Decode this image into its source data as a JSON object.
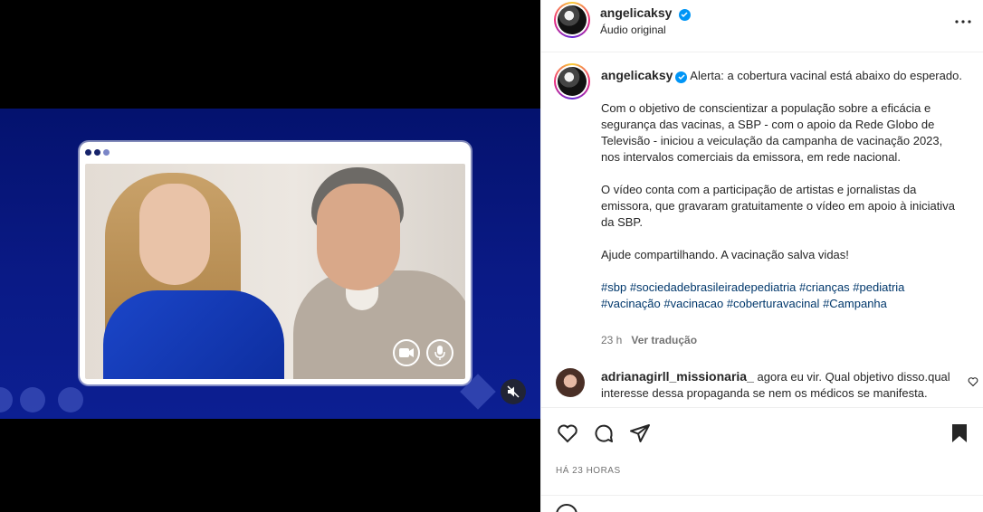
{
  "colors": {
    "video_bg": "#0a1a86",
    "link": "#00376b",
    "verified": "#0095f6",
    "muted": "#737373"
  },
  "header": {
    "username": "angelicaksy",
    "audio": "Áudio original"
  },
  "caption": {
    "username": "angelicaksy",
    "paragraphs": [
      "Alerta: a cobertura vacinal está abaixo do esperado.",
      "Com o objetivo de conscientizar a população sobre a eficácia e segurança das vacinas, a SBP - com o apoio da Rede Globo de Televisão - iniciou a veiculação da campanha de vacinação 2023, nos intervalos comerciais da emissora, em rede nacional.",
      "O vídeo conta com a participação de artistas e jornalistas da emissora, que gravaram gratuitamente o vídeo em apoio à iniciativa da SBP.",
      "Ajude compartilhando. A vacinação salva vidas!"
    ],
    "hashtags": [
      "#sbp",
      "#sociedadebrasileiradepediatria",
      "#crianças",
      "#pediatria",
      "#vacinação",
      "#vacinacao",
      "#coberturavacinal",
      "#Campanha"
    ],
    "age": "23 h",
    "translate": "Ver tradução"
  },
  "comment": {
    "username": "adrianagirll_missionaria_",
    "text": "agora eu vir. Qual objetivo disso.qual interesse dessa propaganda se nem os médicos se manifesta."
  },
  "footer": {
    "posted": "HÁ 23 HORAS"
  },
  "icons": [
    "verified-badge-icon",
    "more-options-icon",
    "camera-icon",
    "microphone-icon",
    "muted-speaker-icon",
    "heart-icon",
    "comment-icon",
    "share-icon",
    "bookmark-icon",
    "emoji-icon"
  ]
}
